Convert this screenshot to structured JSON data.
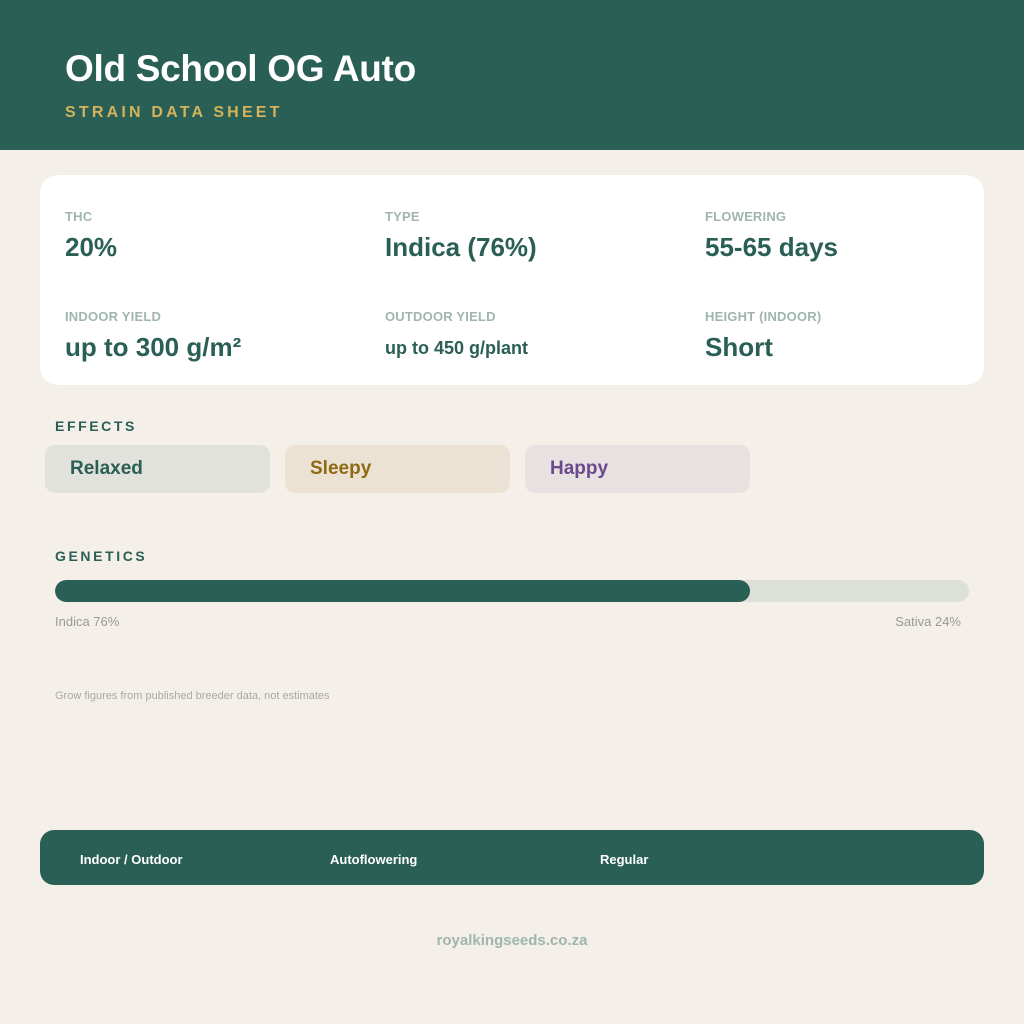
{
  "header": {
    "title": "Old School OG Auto",
    "subtitle": "STRAIN DATA SHEET"
  },
  "stats": {
    "thc": {
      "label": "THC",
      "value": "20%"
    },
    "type": {
      "label": "TYPE",
      "value": "Indica (76%)"
    },
    "flowering": {
      "label": "FLOWERING",
      "value": "55-65 days"
    },
    "indoor_yield": {
      "label": "INDOOR YIELD",
      "value": "up to 300 g/m²"
    },
    "outdoor_yield": {
      "label": "OUTDOOR YIELD",
      "value": "up to 450 g/plant"
    },
    "height": {
      "label": "HEIGHT (INDOOR)",
      "value": "Short"
    }
  },
  "effects": {
    "heading": "EFFECTS",
    "items": [
      {
        "label": "Relaxed",
        "color": "#2a5f56",
        "bg": "#e1e2dc"
      },
      {
        "label": "Sleepy",
        "color": "#8f6a14",
        "bg": "#ece2d4"
      },
      {
        "label": "Happy",
        "color": "#6a4a8c",
        "bg": "#e7e1e1"
      }
    ]
  },
  "genetics": {
    "heading": "GENETICS",
    "indica_fraction": 0.76,
    "indica_label": "Indica 76%",
    "sativa_label": "Sativa 24%"
  },
  "note": "Grow figures from published breeder data, not estimates",
  "footer": {
    "items": [
      "Indoor / Outdoor",
      "Autoflowering",
      "Regular"
    ]
  },
  "website": "royalkingseeds.co.za",
  "colors": {
    "brand": "#2a5f56",
    "accent": "#d4b35a",
    "background": "#f4efe9"
  }
}
